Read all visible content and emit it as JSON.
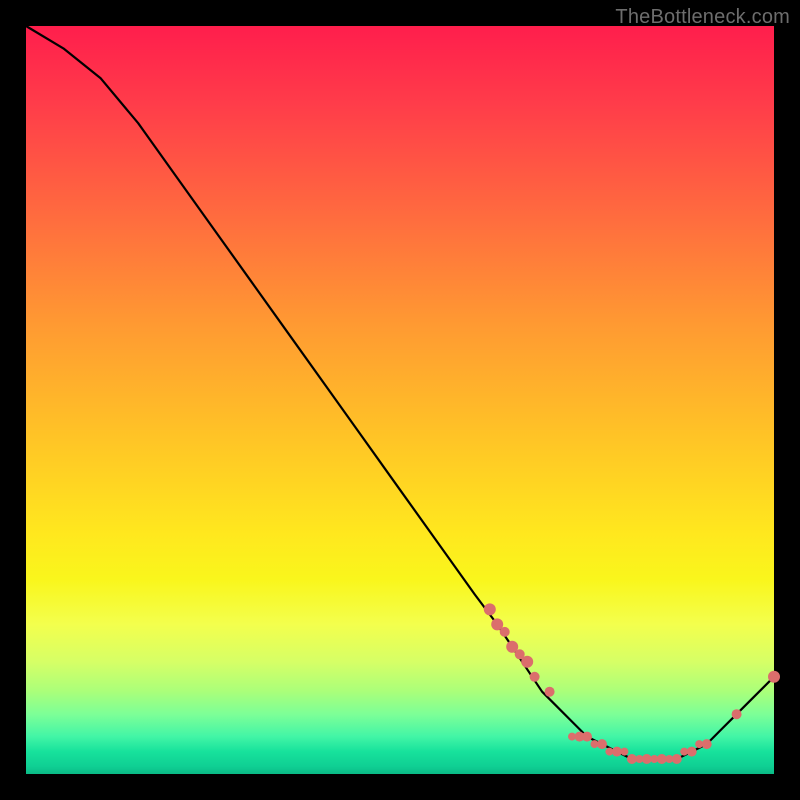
{
  "watermark": "TheBottleneck.com",
  "colors": {
    "bg": "#000000",
    "curve": "#000000",
    "dot": "#db6e6c",
    "gradient_top": "#ff1e4c",
    "gradient_mid": "#ffe81e",
    "gradient_bottom": "#0aba86"
  },
  "chart_data": {
    "type": "line",
    "title": "",
    "xlabel": "",
    "ylabel": "",
    "xlim": [
      0,
      100
    ],
    "ylim": [
      0,
      100
    ],
    "series": [
      {
        "name": "bottleneck-curve",
        "x": [
          0,
          5,
          10,
          15,
          20,
          25,
          30,
          35,
          40,
          45,
          50,
          55,
          60,
          63,
          65,
          67,
          69,
          71,
          73,
          75,
          77,
          79,
          81,
          83,
          85,
          87,
          89,
          91,
          93,
          95,
          97,
          100
        ],
        "y": [
          100,
          97,
          93,
          87,
          80,
          73,
          66,
          59,
          52,
          45,
          38,
          31,
          24,
          20,
          17,
          14,
          11,
          9,
          7,
          5,
          4,
          3,
          2,
          2,
          2,
          2,
          3,
          4,
          6,
          8,
          10,
          13
        ]
      }
    ],
    "highlight_points": {
      "name": "highlighted-region-dots",
      "x": [
        62,
        63,
        64,
        65,
        66,
        67,
        68,
        70,
        73,
        74,
        75,
        76,
        77,
        78,
        79,
        80,
        81,
        82,
        83,
        84,
        85,
        86,
        87,
        88,
        89,
        90,
        91,
        95,
        100
      ],
      "y": [
        22,
        20,
        19,
        17,
        16,
        15,
        13,
        11,
        5,
        5,
        5,
        4,
        4,
        3,
        3,
        3,
        2,
        2,
        2,
        2,
        2,
        2,
        2,
        3,
        3,
        4,
        4,
        8,
        13
      ],
      "r": [
        6,
        6,
        5,
        6,
        5,
        6,
        5,
        5,
        4,
        5,
        5,
        4,
        5,
        4,
        5,
        4,
        5,
        4,
        5,
        4,
        5,
        4,
        5,
        4,
        5,
        4,
        5,
        5,
        6
      ]
    }
  }
}
